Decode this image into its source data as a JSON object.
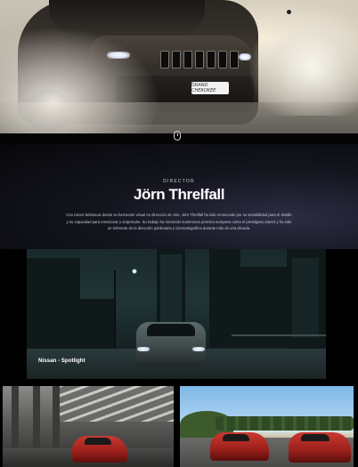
{
  "hero": {
    "plate_text": "GRAND CHEROKEE",
    "scroll_icon": "mouse-scroll-icon"
  },
  "director": {
    "eyebrow": "DIRECTOR",
    "name": "Jörn Threlfall",
    "bio": "Con raíces británicas desde su formación visual en dirección de cine, Jörn Threlfall ha sido reconocido por su sensibilidad para el detalle y su capacidad para emocionar y sorprender. Su trabajo ha merecido numerosos premios europeos como el prestigioso D&AD y ha sido un referente de la dirección publicitaria y cinematográfica durante más de una década."
  },
  "projects": {
    "featured_caption": "Nissan - Spotlight"
  }
}
